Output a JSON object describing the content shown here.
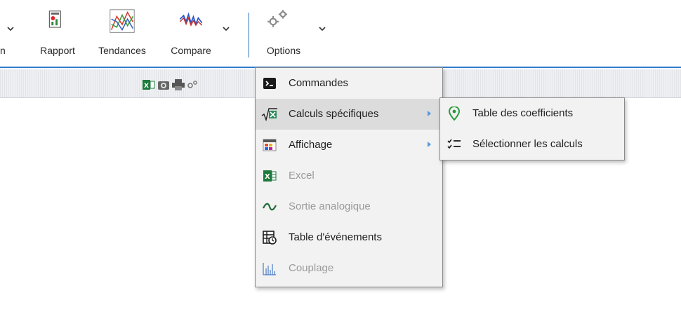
{
  "ribbon": {
    "left_partial_label": "n",
    "buttons": [
      {
        "label": "Rapport"
      },
      {
        "label": "Tendances"
      },
      {
        "label": "Compare"
      },
      {
        "label": "Options"
      }
    ]
  },
  "options_menu": {
    "items": [
      {
        "label": "Commandes",
        "icon": "terminal-icon",
        "enabled": true
      },
      {
        "label": "Calculs spécifiques",
        "icon": "sqrt-calc-icon",
        "enabled": true,
        "has_submenu": true,
        "highlighted": true
      },
      {
        "label": "Affichage",
        "icon": "display-palette-icon",
        "enabled": true,
        "has_submenu": true
      },
      {
        "label": "Excel",
        "icon": "excel-icon",
        "enabled": false
      },
      {
        "label": "Sortie analogique",
        "icon": "wave-icon",
        "enabled": false
      },
      {
        "label": "Table d'événements",
        "icon": "event-table-icon",
        "enabled": true
      },
      {
        "label": "Couplage",
        "icon": "coupling-chart-icon",
        "enabled": false
      }
    ]
  },
  "submenu": {
    "items": [
      {
        "label": "Table des coefficients",
        "icon": "map-pin-icon"
      },
      {
        "label": "Sélectionner les calculs",
        "icon": "checklist-icon"
      }
    ]
  },
  "toolbar_strip": {
    "icons": [
      "excel-icon",
      "camera-icon",
      "print-icon",
      "gears-icon"
    ]
  },
  "colors": {
    "accent_blue": "#2f7ccd",
    "menu_bg": "#f2f2f2",
    "highlight": "#dcdcdc",
    "disabled_text": "#9a9a9a"
  }
}
